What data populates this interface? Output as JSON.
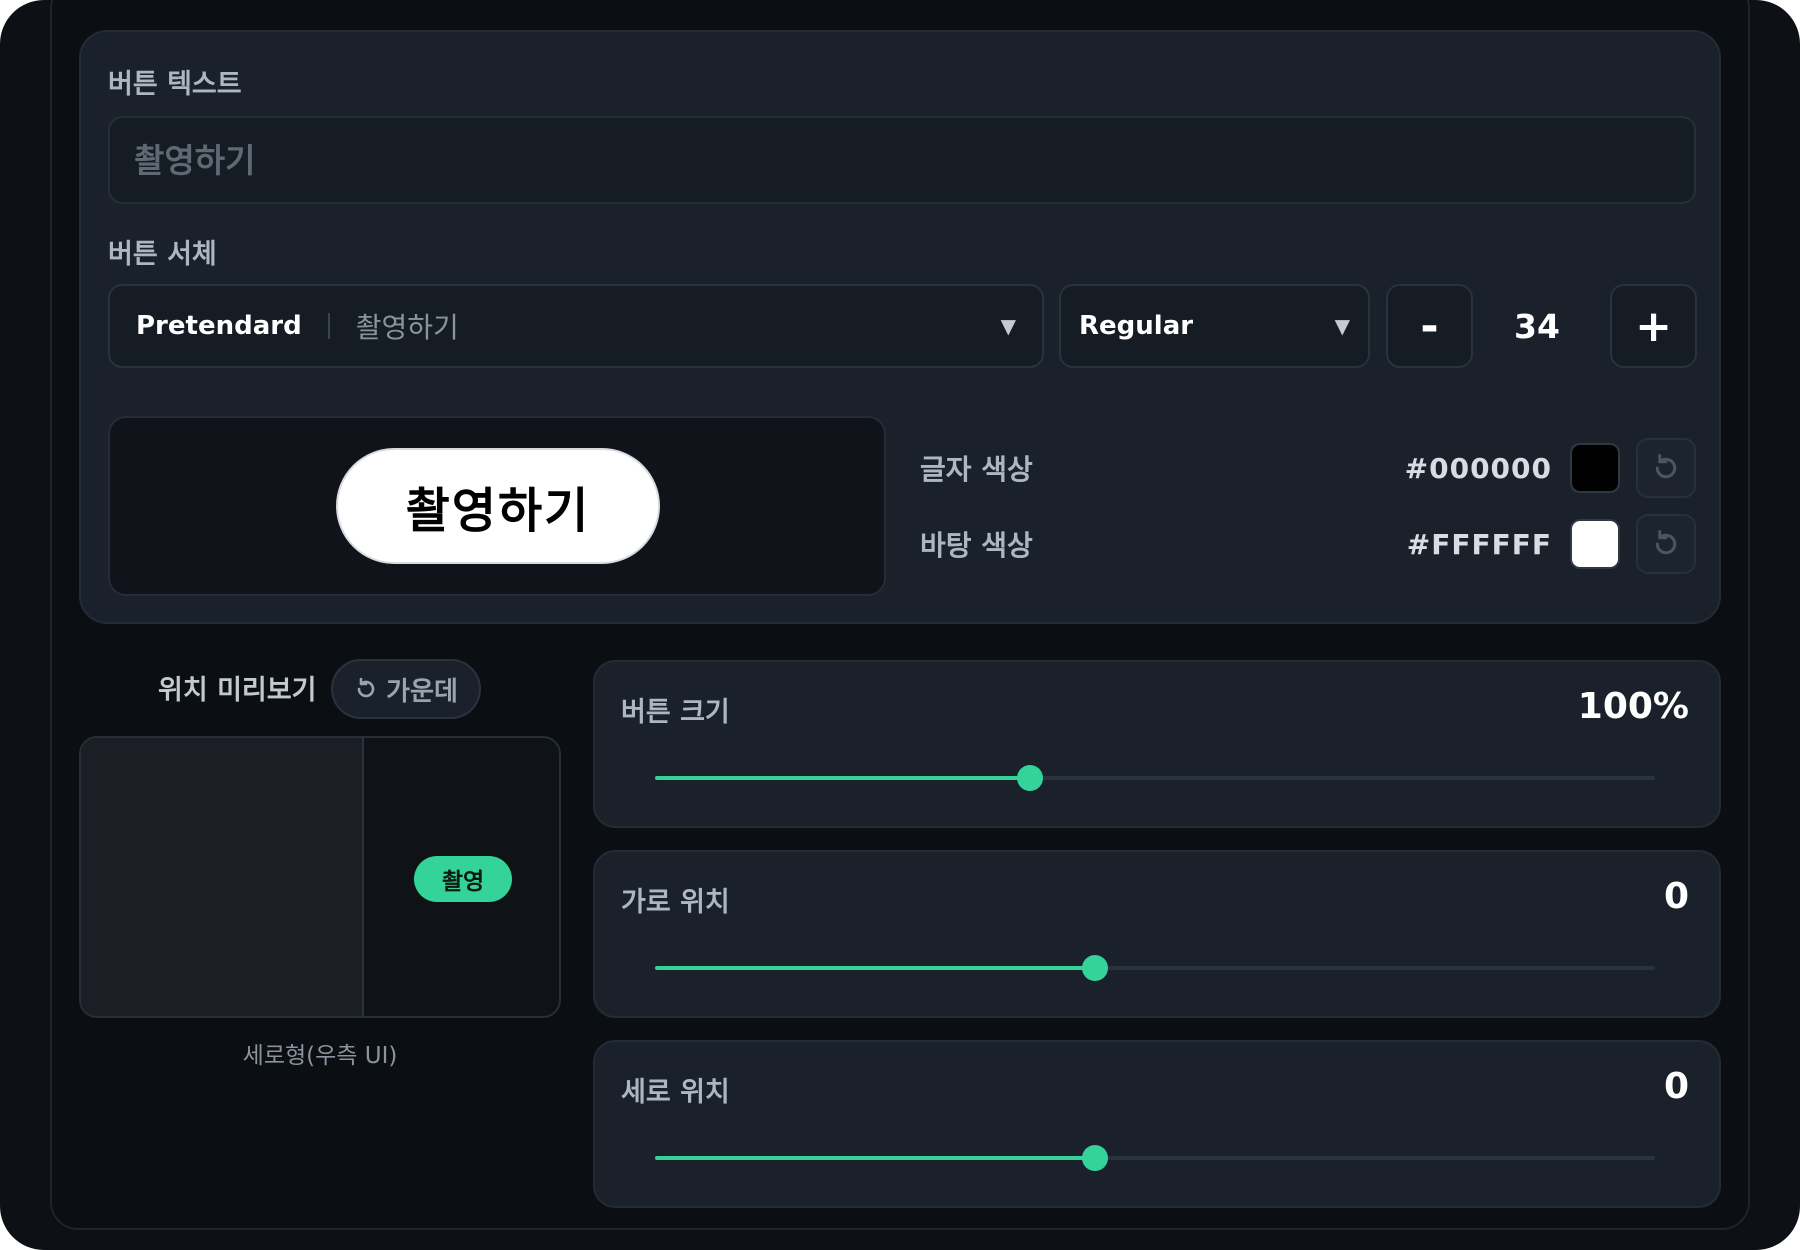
{
  "button_text": {
    "label": "버튼 텍스트",
    "placeholder": "촬영하기",
    "value": ""
  },
  "button_font": {
    "label": "버튼 서체",
    "family": "Pretendard",
    "sample": "촬영하기",
    "weight": "Regular",
    "size": "34",
    "minus_label": "-",
    "plus_label": "+"
  },
  "preview": {
    "button_label": "촬영하기"
  },
  "colors": {
    "text": {
      "label": "글자 색상",
      "hex": "#000000"
    },
    "background": {
      "label": "바탕 색상",
      "hex": "#FFFFFF"
    }
  },
  "position_preview": {
    "title": "위치 미리보기",
    "center_label": "가운데",
    "pill_label": "촬영",
    "caption": "세로형(우측 UI)"
  },
  "sliders": [
    {
      "name": "size",
      "label": "버튼 크기",
      "display": "100%",
      "fraction": 0.375
    },
    {
      "name": "horizontal",
      "label": "가로 위치",
      "display": "0",
      "fraction": 0.44
    },
    {
      "name": "vertical",
      "label": "세로 위치",
      "display": "0",
      "fraction": 0.44
    }
  ]
}
